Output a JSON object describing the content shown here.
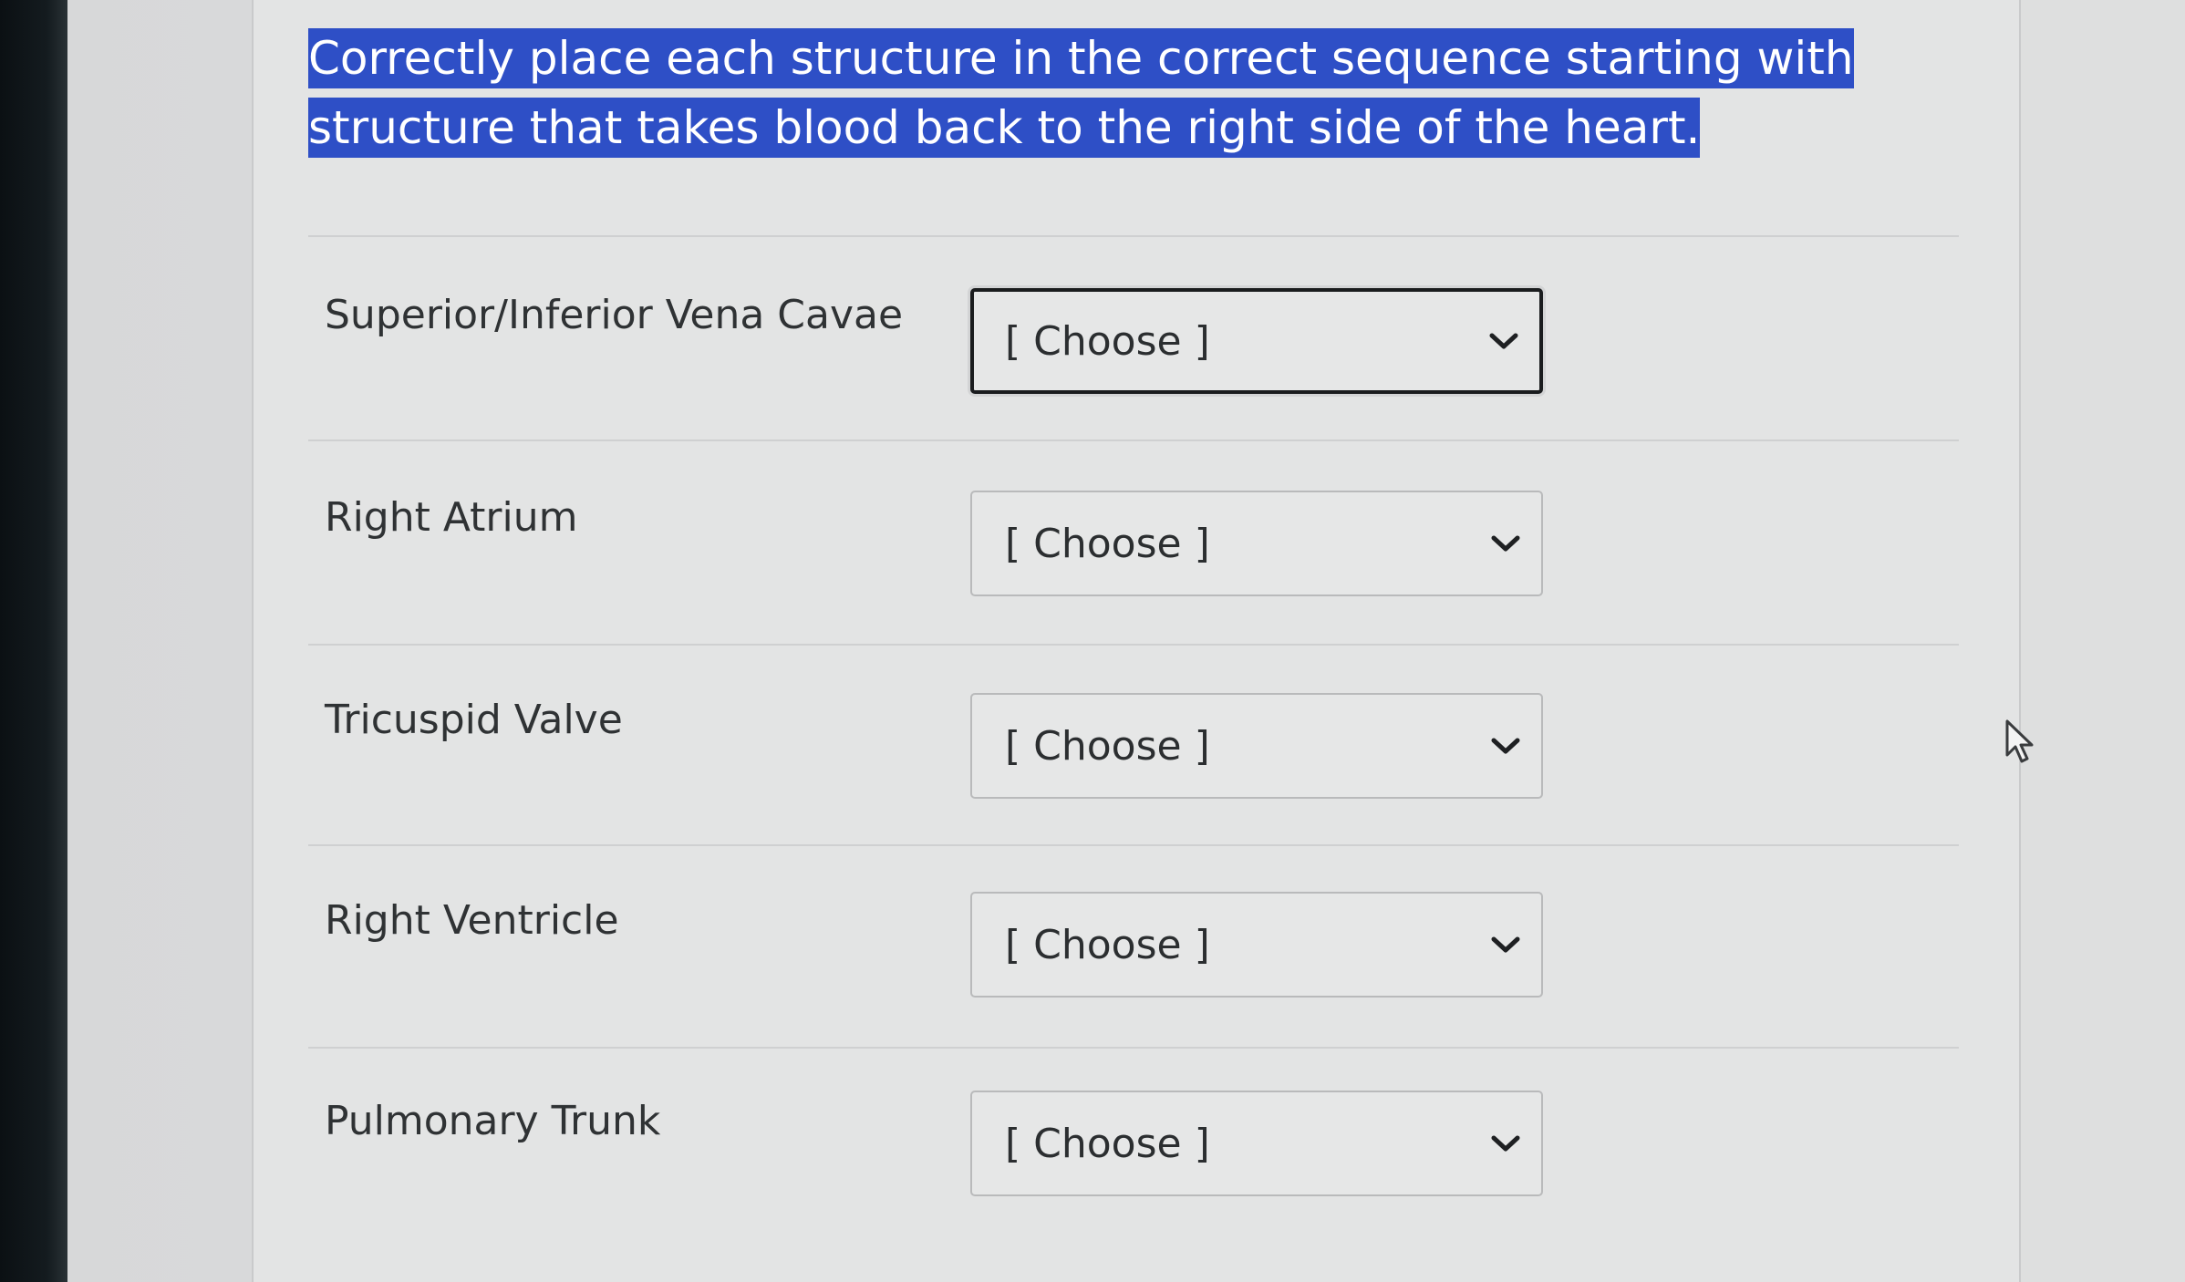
{
  "question": {
    "text": "Correctly place each structure in the correct sequence starting with structure that takes blood back to the right side of the heart."
  },
  "rows": [
    {
      "label": "Superior/Inferior Vena Cavae",
      "selected": "[ Choose ]"
    },
    {
      "label": "Right Atrium",
      "selected": "[ Choose ]"
    },
    {
      "label": "Tricuspid Valve",
      "selected": "[ Choose ]"
    },
    {
      "label": "Right Ventricle",
      "selected": "[ Choose ]"
    },
    {
      "label": "Pulmonary Trunk",
      "selected": "[ Choose ]"
    }
  ],
  "colors": {
    "selection_highlight": "#2e4fc6",
    "label_text": "#2f3234"
  },
  "icons": {
    "dropdown": "chevron-down-icon",
    "pointer": "mouse-pointer-icon"
  }
}
